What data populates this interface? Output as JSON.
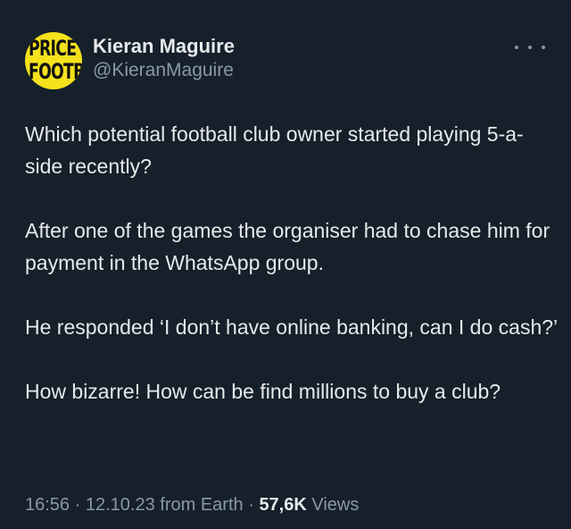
{
  "author": {
    "display_name": "Kieran Maguire",
    "handle": "@KieranMaguire",
    "avatar_text_line1": "PRICE O",
    "avatar_text_line2": "FOOTBA",
    "avatar_color": "#f5e21c"
  },
  "tweet": {
    "paragraphs": [
      "Which potential football club owner started playing 5-a-side recently?",
      "After one of the games the organiser had to chase him for payment in the WhatsApp group.",
      "He responded ‘I don’t have online banking, can I do cash?’",
      "How bizarre! How can be find millions to buy a club?"
    ]
  },
  "meta": {
    "time": "16:56",
    "separator": "·",
    "date": "12.10.23",
    "source": "from Earth",
    "views_count": "57,6K",
    "views_label": "Views"
  },
  "colors": {
    "background": "#15202b",
    "primary_text": "#e7e9ea",
    "secondary_text": "#8b98a5"
  },
  "icons": {
    "more": "more-horizontal-icon"
  }
}
